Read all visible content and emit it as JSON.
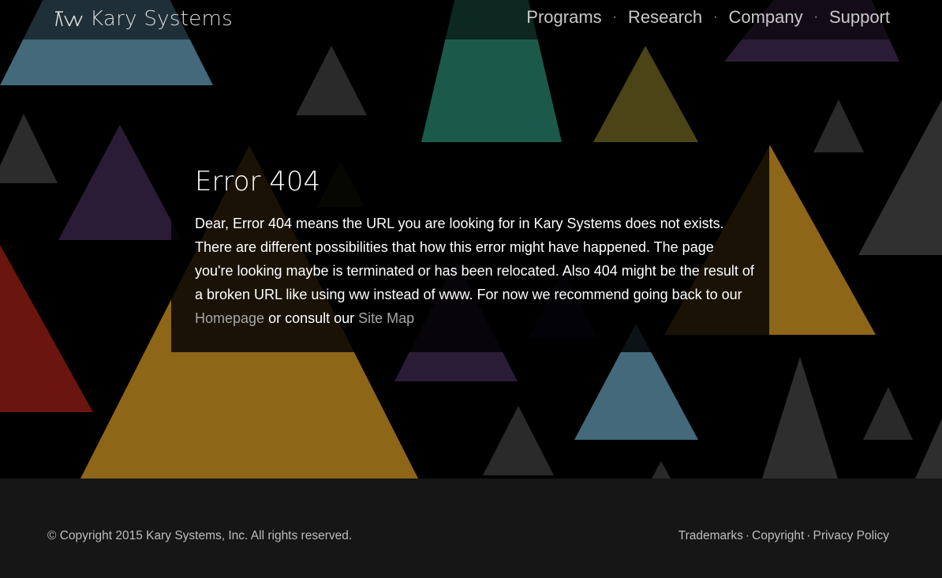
{
  "header": {
    "brand": "Kary Systems",
    "nav": [
      {
        "label": "Programs"
      },
      {
        "label": "Research"
      },
      {
        "label": "Company"
      },
      {
        "label": "Support"
      }
    ],
    "separator": "·"
  },
  "main": {
    "title": "Error 404",
    "body_text": "Dear, Error 404 means the URL you are looking for in Kary Systems does not exists. There are different possibilities that how this error might have happened. The page you're looking maybe is terminated or has been relocated. Also 404 might be the result of a broken URL like using ww instead of www. For now we recommend going back to our ",
    "homepage_link": "Homepage",
    "middle_text": " or consult our ",
    "sitemap_link": "Site Map"
  },
  "footer": {
    "copyright": "© Copyright 2015 Kary Systems, Inc. All rights reserved.",
    "links": [
      {
        "label": "Trademarks"
      },
      {
        "label": "Copyright"
      },
      {
        "label": "Privacy Policy"
      }
    ],
    "separator": "·"
  },
  "colors": {
    "teal": "#1b5a4a",
    "steel_blue": "#43697a",
    "olive": "#4a4417",
    "purple": "#2a1c36",
    "gold": "#8e6618",
    "red": "#6b150f",
    "gray": "#303030",
    "footer_bg": "#161616"
  }
}
